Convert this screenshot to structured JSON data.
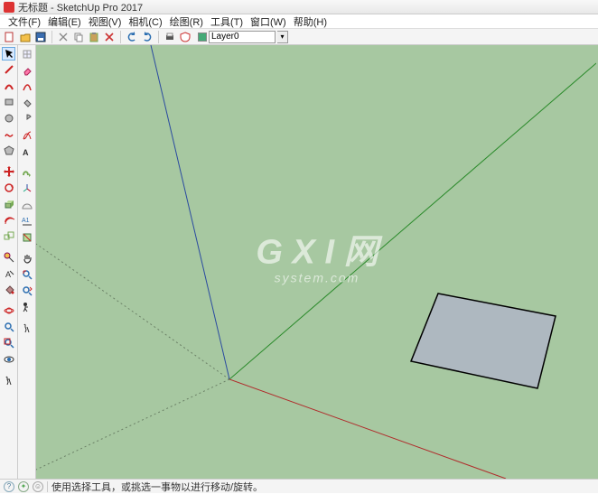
{
  "title": "无标题 - SketchUp Pro 2017",
  "menus": [
    "文件(F)",
    "编辑(E)",
    "视图(V)",
    "相机(C)",
    "绘图(R)",
    "工具(T)",
    "窗口(W)",
    "帮助(H)"
  ],
  "layer": {
    "selected": "Layer0"
  },
  "status": {
    "text": "使用选择工具，或挑选一事物以进行移动/旋转。"
  },
  "watermark": {
    "main": "G X I 网",
    "sub": "system.com"
  },
  "colors": {
    "bg": "#a7c8a1",
    "axis_x": "#b02b2b",
    "axis_y": "#2a8a2a",
    "axis_z": "#2a4aa0",
    "face": "#aeb8c0"
  }
}
